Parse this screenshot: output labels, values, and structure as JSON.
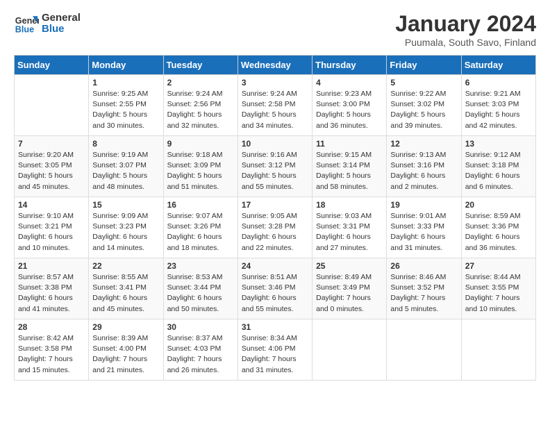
{
  "logo": {
    "line1": "General",
    "line2": "Blue"
  },
  "title": "January 2024",
  "subtitle": "Puumala, South Savo, Finland",
  "header_days": [
    "Sunday",
    "Monday",
    "Tuesday",
    "Wednesday",
    "Thursday",
    "Friday",
    "Saturday"
  ],
  "weeks": [
    [
      {
        "day": "",
        "info": ""
      },
      {
        "day": "1",
        "info": "Sunrise: 9:25 AM\nSunset: 2:55 PM\nDaylight: 5 hours\nand 30 minutes."
      },
      {
        "day": "2",
        "info": "Sunrise: 9:24 AM\nSunset: 2:56 PM\nDaylight: 5 hours\nand 32 minutes."
      },
      {
        "day": "3",
        "info": "Sunrise: 9:24 AM\nSunset: 2:58 PM\nDaylight: 5 hours\nand 34 minutes."
      },
      {
        "day": "4",
        "info": "Sunrise: 9:23 AM\nSunset: 3:00 PM\nDaylight: 5 hours\nand 36 minutes."
      },
      {
        "day": "5",
        "info": "Sunrise: 9:22 AM\nSunset: 3:02 PM\nDaylight: 5 hours\nand 39 minutes."
      },
      {
        "day": "6",
        "info": "Sunrise: 9:21 AM\nSunset: 3:03 PM\nDaylight: 5 hours\nand 42 minutes."
      }
    ],
    [
      {
        "day": "7",
        "info": "Sunrise: 9:20 AM\nSunset: 3:05 PM\nDaylight: 5 hours\nand 45 minutes."
      },
      {
        "day": "8",
        "info": "Sunrise: 9:19 AM\nSunset: 3:07 PM\nDaylight: 5 hours\nand 48 minutes."
      },
      {
        "day": "9",
        "info": "Sunrise: 9:18 AM\nSunset: 3:09 PM\nDaylight: 5 hours\nand 51 minutes."
      },
      {
        "day": "10",
        "info": "Sunrise: 9:16 AM\nSunset: 3:12 PM\nDaylight: 5 hours\nand 55 minutes."
      },
      {
        "day": "11",
        "info": "Sunrise: 9:15 AM\nSunset: 3:14 PM\nDaylight: 5 hours\nand 58 minutes."
      },
      {
        "day": "12",
        "info": "Sunrise: 9:13 AM\nSunset: 3:16 PM\nDaylight: 6 hours\nand 2 minutes."
      },
      {
        "day": "13",
        "info": "Sunrise: 9:12 AM\nSunset: 3:18 PM\nDaylight: 6 hours\nand 6 minutes."
      }
    ],
    [
      {
        "day": "14",
        "info": "Sunrise: 9:10 AM\nSunset: 3:21 PM\nDaylight: 6 hours\nand 10 minutes."
      },
      {
        "day": "15",
        "info": "Sunrise: 9:09 AM\nSunset: 3:23 PM\nDaylight: 6 hours\nand 14 minutes."
      },
      {
        "day": "16",
        "info": "Sunrise: 9:07 AM\nSunset: 3:26 PM\nDaylight: 6 hours\nand 18 minutes."
      },
      {
        "day": "17",
        "info": "Sunrise: 9:05 AM\nSunset: 3:28 PM\nDaylight: 6 hours\nand 22 minutes."
      },
      {
        "day": "18",
        "info": "Sunrise: 9:03 AM\nSunset: 3:31 PM\nDaylight: 6 hours\nand 27 minutes."
      },
      {
        "day": "19",
        "info": "Sunrise: 9:01 AM\nSunset: 3:33 PM\nDaylight: 6 hours\nand 31 minutes."
      },
      {
        "day": "20",
        "info": "Sunrise: 8:59 AM\nSunset: 3:36 PM\nDaylight: 6 hours\nand 36 minutes."
      }
    ],
    [
      {
        "day": "21",
        "info": "Sunrise: 8:57 AM\nSunset: 3:38 PM\nDaylight: 6 hours\nand 41 minutes."
      },
      {
        "day": "22",
        "info": "Sunrise: 8:55 AM\nSunset: 3:41 PM\nDaylight: 6 hours\nand 45 minutes."
      },
      {
        "day": "23",
        "info": "Sunrise: 8:53 AM\nSunset: 3:44 PM\nDaylight: 6 hours\nand 50 minutes."
      },
      {
        "day": "24",
        "info": "Sunrise: 8:51 AM\nSunset: 3:46 PM\nDaylight: 6 hours\nand 55 minutes."
      },
      {
        "day": "25",
        "info": "Sunrise: 8:49 AM\nSunset: 3:49 PM\nDaylight: 7 hours\nand 0 minutes."
      },
      {
        "day": "26",
        "info": "Sunrise: 8:46 AM\nSunset: 3:52 PM\nDaylight: 7 hours\nand 5 minutes."
      },
      {
        "day": "27",
        "info": "Sunrise: 8:44 AM\nSunset: 3:55 PM\nDaylight: 7 hours\nand 10 minutes."
      }
    ],
    [
      {
        "day": "28",
        "info": "Sunrise: 8:42 AM\nSunset: 3:58 PM\nDaylight: 7 hours\nand 15 minutes."
      },
      {
        "day": "29",
        "info": "Sunrise: 8:39 AM\nSunset: 4:00 PM\nDaylight: 7 hours\nand 21 minutes."
      },
      {
        "day": "30",
        "info": "Sunrise: 8:37 AM\nSunset: 4:03 PM\nDaylight: 7 hours\nand 26 minutes."
      },
      {
        "day": "31",
        "info": "Sunrise: 8:34 AM\nSunset: 4:06 PM\nDaylight: 7 hours\nand 31 minutes."
      },
      {
        "day": "",
        "info": ""
      },
      {
        "day": "",
        "info": ""
      },
      {
        "day": "",
        "info": ""
      }
    ]
  ]
}
